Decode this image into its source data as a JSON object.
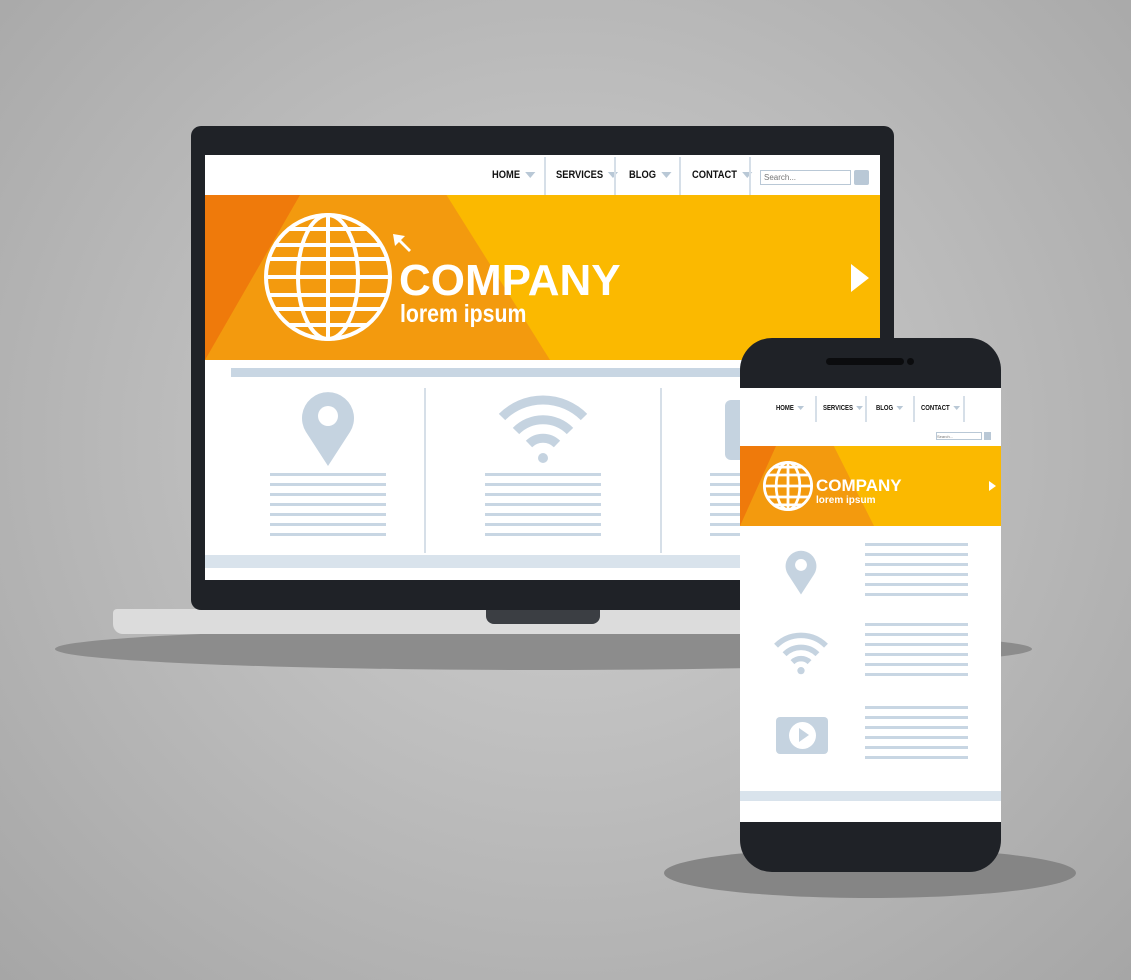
{
  "laptop": {
    "nav": {
      "items": [
        {
          "label": "HOME"
        },
        {
          "label": "SERVICES"
        },
        {
          "label": "BLOG"
        },
        {
          "label": "CONTACT"
        }
      ],
      "search_placeholder": "Search..."
    },
    "banner": {
      "title": "COMPANY",
      "subtitle": "lorem ipsum"
    },
    "features": [
      {
        "icon": "location-pin-icon"
      },
      {
        "icon": "wifi-icon"
      },
      {
        "icon": "video-play-icon"
      }
    ]
  },
  "phone": {
    "nav": {
      "items": [
        {
          "label": "HOME"
        },
        {
          "label": "SERVICES"
        },
        {
          "label": "BLOG"
        },
        {
          "label": "CONTACT"
        }
      ],
      "search_placeholder": "Search..."
    },
    "banner": {
      "title": "COMPANY",
      "subtitle": "lorem ipsum"
    },
    "features": [
      {
        "icon": "location-pin-icon"
      },
      {
        "icon": "wifi-icon"
      },
      {
        "icon": "video-play-icon"
      }
    ]
  },
  "colors": {
    "orange_dark": "#ef7a0b",
    "orange_mid": "#f39a0e",
    "yellow": "#fbb900",
    "device": "#1f2227",
    "accent_gray": "#c5d3e0"
  }
}
